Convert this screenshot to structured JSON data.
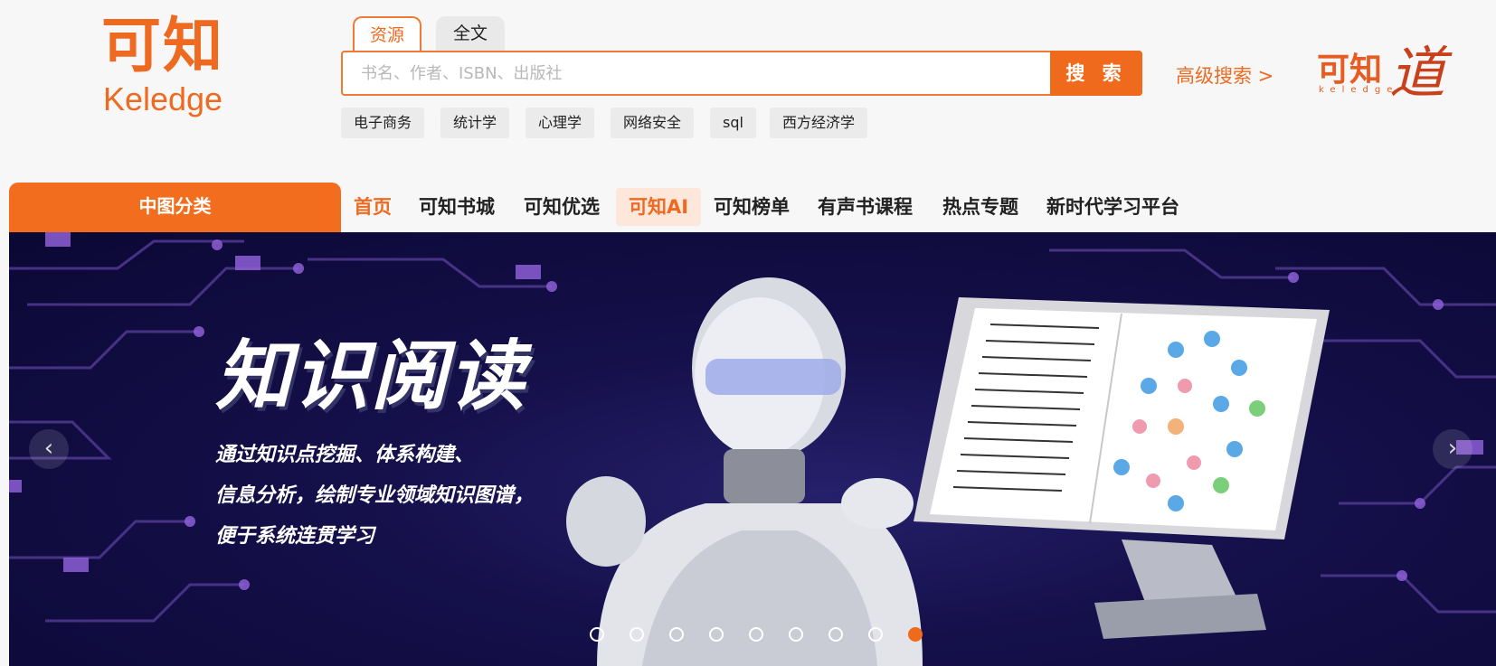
{
  "logo": {
    "zh": "可知",
    "en": "Keledge"
  },
  "search": {
    "tabs": [
      {
        "label": "资源"
      },
      {
        "label": "全文"
      }
    ],
    "placeholder": "书名、作者、ISBN、出版社",
    "button_label": "搜 索",
    "advanced_label": "高级搜索 >"
  },
  "partner_logo": {
    "zh": "可知",
    "dao": "道",
    "en": "keledge"
  },
  "hot_tags": [
    {
      "label": "电子商务"
    },
    {
      "label": "统计学"
    },
    {
      "label": "心理学"
    },
    {
      "label": "网络安全"
    },
    {
      "label": "sql"
    },
    {
      "label": "西方经济学"
    }
  ],
  "category_button": "中图分类",
  "nav": {
    "items": [
      {
        "label": "首页"
      },
      {
        "label": "可知书城"
      },
      {
        "label": "可知优选"
      },
      {
        "label": "可知AI"
      },
      {
        "label": "可知榜单"
      },
      {
        "label": "有声书课程"
      },
      {
        "label": "热点专题"
      },
      {
        "label": "新时代学习平台"
      }
    ]
  },
  "banner": {
    "headline": "知识阅读",
    "lines": [
      "通过知识点挖掘、体系构建、",
      "信息分析，绘制专业领域知识图谱，",
      "便于系统连贯学习"
    ],
    "prev_icon": "‹",
    "next_icon": "›",
    "slide_count": 9,
    "active_slide": 9
  },
  "colors": {
    "accent": "#f06a1d",
    "banner_bg": "#15104a"
  }
}
